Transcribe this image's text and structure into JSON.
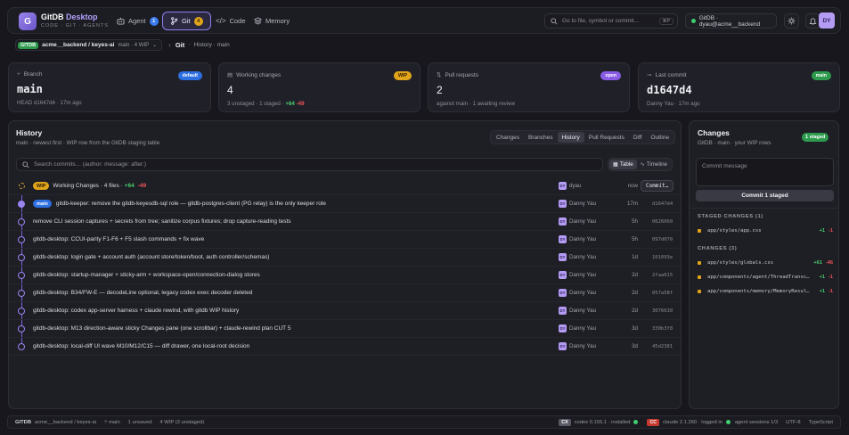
{
  "app": {
    "name": "GitDB",
    "name_accent": "Desktop",
    "tagline": "CODE · GIT · AGENTS",
    "logo_glyph": "G"
  },
  "nav": {
    "tabs": [
      {
        "label": "Agent",
        "badge": "1",
        "badge_color": "#3b7df0"
      },
      {
        "label": "Git",
        "badge": "4",
        "badge_color": "#e0a41a",
        "active": true
      },
      {
        "label": "Code"
      },
      {
        "label": "Memory"
      }
    ]
  },
  "search": {
    "placeholder": "Go to file, symbol or commit…",
    "shortcut": "⌘P"
  },
  "user": {
    "label": "GitDB · dyau@acme__backend",
    "initials": "DY"
  },
  "breadcrumb": {
    "badge": "GITDB",
    "repo": "acme__backend / keyes-ai",
    "branch": "main · 4 WIP",
    "section": "Git",
    "path": "History · main"
  },
  "cards": [
    {
      "label": "Branch",
      "badge": "default",
      "badge_bg": "#2d6fe0",
      "value": "main",
      "mono": true,
      "sub": "HEAD d1647d4 · 17m ago"
    },
    {
      "label": "Working changes",
      "badge": "WIP",
      "badge_bg": "#e0a41a",
      "value": "4",
      "sub_prefix": "3 unstaged · 1 staged · ",
      "plus": "+64",
      "minus": "-49"
    },
    {
      "label": "Pull requests",
      "badge": "open",
      "badge_bg": "#8a5ce6",
      "value": "2",
      "sub": "against main · 1 awaiting review"
    },
    {
      "label": "Last commit",
      "badge": "main",
      "badge_bg": "#2e9a4e",
      "value": "d1647d4",
      "mono": true,
      "sub": "Danny Yau · 17m ago"
    }
  ],
  "history": {
    "title": "History",
    "subtitle": "main · newest first · WIP row from the GitDB staging table",
    "tabs": [
      "Changes",
      "Branches",
      "History",
      "Pull Requests",
      "Diff",
      "Outline"
    ],
    "active_tab": "History",
    "search_placeholder": "Search commits… (author: message: after:)",
    "views": [
      "Table",
      "Timeline"
    ],
    "wip": {
      "badge": "WIP",
      "label": "Working Changes · 4 files · ",
      "plus": "+64",
      "minus": "-49",
      "author": "dyau",
      "initials": "DY",
      "time": "now",
      "button": "Commit…"
    },
    "commits": [
      {
        "branch": "main",
        "message": "gitdb-keeper: remove the gitdb-keyesdb-sql role — gitdb-postgres-client (PG relay) is the only keeper role",
        "author": "Danny Yau",
        "initials": "DY",
        "time": "17m",
        "hash": "d1647d4"
      },
      {
        "message": "remove CLI session captures + secrets from tree; sanitize corpus fixtures; drop capture-reading tests",
        "author": "Danny Yau",
        "initials": "DY",
        "time": "5h",
        "hash": "0626060"
      },
      {
        "message": "gitdb-desktop: CCUI-parity F1-F6 + F5 slash commands + fix wave",
        "author": "Danny Yau",
        "initials": "DY",
        "time": "5h",
        "hash": "097d070"
      },
      {
        "message": "gitdb-desktop: login gate + account auth (account store/token/boot, auth controller/schemas)",
        "author": "Danny Yau",
        "initials": "DY",
        "time": "1d",
        "hash": "101093e"
      },
      {
        "message": "gitdb-desktop: startup-manager + sticky-arm + workspace-open/connection-dialog stores",
        "author": "Danny Yau",
        "initials": "DY",
        "time": "2d",
        "hash": "2faa015"
      },
      {
        "message": "gitdb-desktop: B34/FW-E — decodeLine optional, legacy codex exec decoder deleted",
        "author": "Danny Yau",
        "initials": "DY",
        "time": "2d",
        "hash": "057a58f"
      },
      {
        "message": "gitdb-desktop: codex app-server harness + claude rewind, with gitdb WIP history",
        "author": "Danny Yau",
        "initials": "DY",
        "time": "2d",
        "hash": "3076630"
      },
      {
        "message": "gitdb-desktop: M13 direction-aware sticky Changes pane (one scrollbar) + claude-rewind plan CUT 5",
        "author": "Danny Yau",
        "initials": "DY",
        "time": "3d",
        "hash": "330b3f8"
      },
      {
        "message": "gitdb-desktop: local-diff UI wave M10/M12/C15 — diff drawer, one local-root decision",
        "author": "Danny Yau",
        "initials": "DY",
        "time": "3d",
        "hash": "45d2381"
      }
    ]
  },
  "changes": {
    "title": "Changes",
    "subtitle": "GitDB · main · your WIP rows",
    "badge": "1 staged",
    "commit_placeholder": "Commit message",
    "commit_button": "Commit 1 staged",
    "staged_header": "STAGED CHANGES (1)",
    "staged": [
      {
        "file": "app/styles/app.css",
        "plus": "+1",
        "minus": "-1"
      }
    ],
    "changes_header": "CHANGES (3)",
    "files": [
      {
        "file": "app/styles/globals.css",
        "plus": "+61",
        "minus": "-46"
      },
      {
        "file": "app/components/agent/ThreadTransc…",
        "plus": "+1",
        "minus": "-1"
      },
      {
        "file": "app/components/memory/MemoryResul…",
        "plus": "+1",
        "minus": "-1"
      }
    ]
  },
  "statusbar": {
    "badge": "GITDB",
    "repo": "acme__backend / keyes-ai",
    "branch": "⑂ main",
    "unsaved": "1 unsaved",
    "wip": "4 WIP (3 unstaged)",
    "cx_badge": "CX",
    "cx": "codex 0.155.1 · installed",
    "cc_badge": "CC",
    "cc": "claude 2.1.260 · logged in",
    "sessions": "agent sessions 1/3",
    "encoding": "UTF-8",
    "language": "TypeScript"
  }
}
